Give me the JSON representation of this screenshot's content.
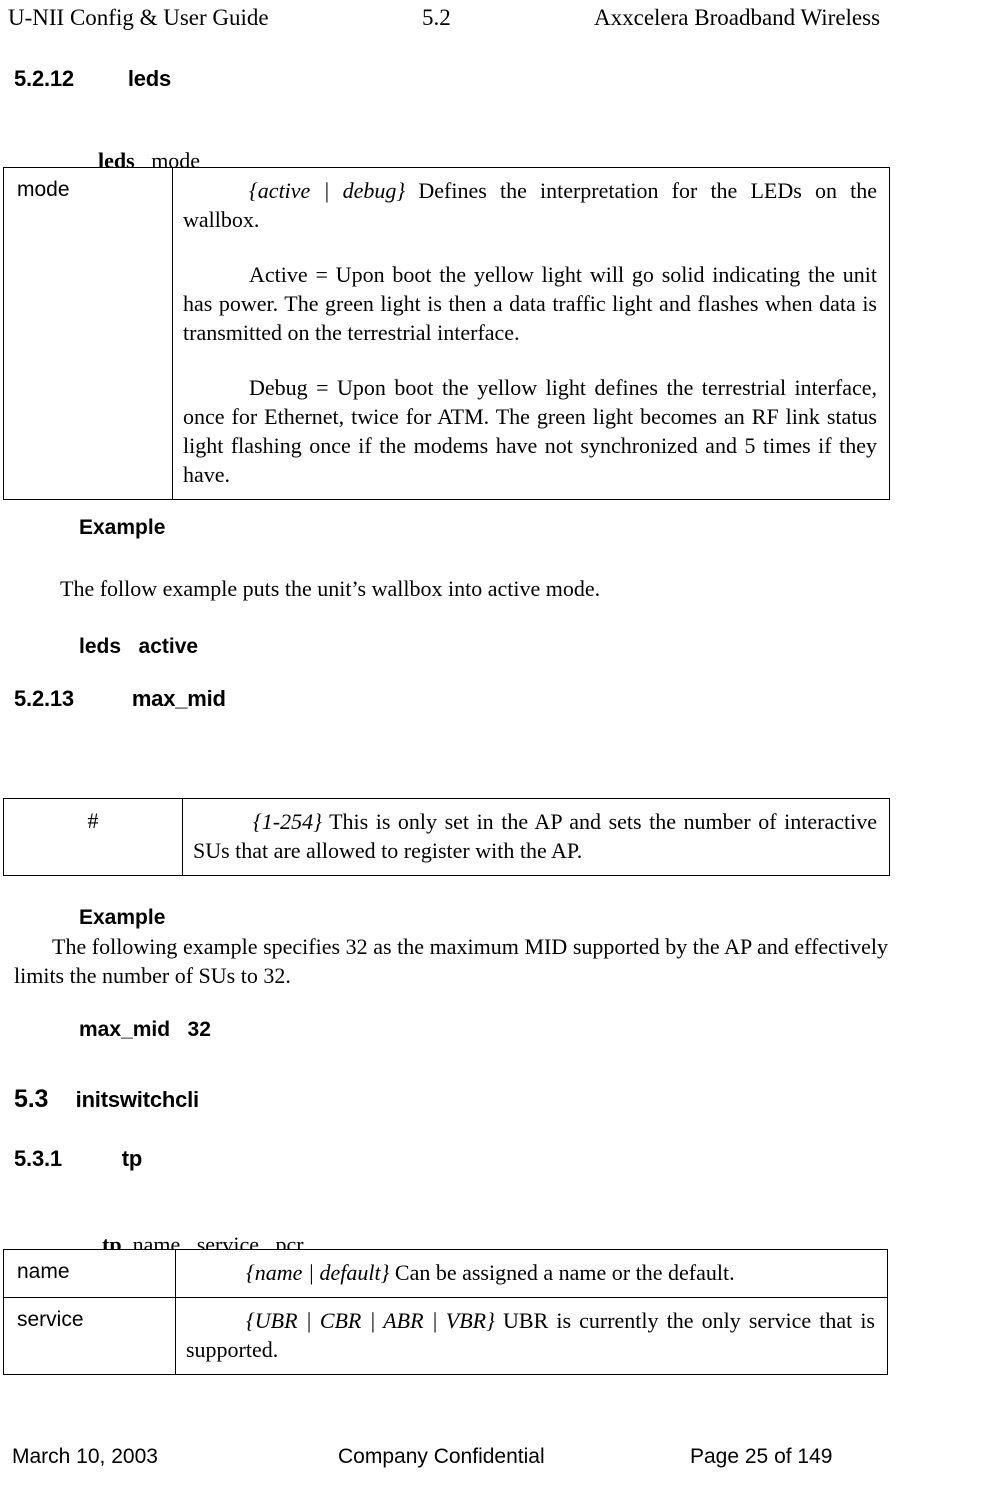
{
  "header": {
    "left": "U-NII Config & User Guide",
    "center": "5.2",
    "right": "Axxcelera Broadband Wireless"
  },
  "footer": {
    "left": "March 10, 2003",
    "center": "Company Confidential",
    "right": "Page 25 of 149"
  },
  "sections": {
    "leds": {
      "number": "5.2.12",
      "title": "leds",
      "syntax_cmd": "leds",
      "syntax_args": "mode",
      "table": {
        "param": "mode",
        "def_prefix": "{active | debug}",
        "def_text": " Defines the interpretation for the LEDs on the wallbox.",
        "active_text": "Active = Upon boot the yellow light will go solid indicating the unit has power. The green light is then a data traffic light and flashes when data is transmitted on the terrestrial interface.",
        "debug_text": "Debug = Upon boot the yellow light defines the terrestrial interface, once for Ethernet, twice for ATM. The green light becomes an RF link status light flashing once if the modems have not synchronized and 5 times if they have."
      },
      "example_label": "Example",
      "example_text": "The follow example puts the unit’s wallbox into active mode.",
      "example_cmd": "leds   active"
    },
    "max_mid": {
      "number": "5.2.13",
      "title": "max_mid",
      "syntax_cmd": "max_mid",
      "syntax_args": "#",
      "table": {
        "param": "#",
        "def_prefix": "{1-254}",
        "def_text": " This is only set in the AP and sets the number of interactive SUs that are allowed to register with the AP."
      },
      "example_label": "Example",
      "example_text": "The following example specifies 32 as the maximum MID supported by the AP and effectively limits the number of SUs to 32.",
      "example_cmd": "max_mid   32"
    },
    "initswitchcli": {
      "number": "5.3",
      "title": "initswitchcli"
    },
    "tp": {
      "number": "5.3.1",
      "title": "tp",
      "syntax_cmd": "tp",
      "syntax_args": "name   service   pcr",
      "rows": [
        {
          "param": "name",
          "def_prefix": "{name | default}",
          "def_text": " Can be assigned a name or the default."
        },
        {
          "param": "service",
          "def_prefix": "{UBR | CBR | ABR | VBR}",
          "def_text": " UBR is currently the only service that is supported."
        }
      ]
    }
  }
}
